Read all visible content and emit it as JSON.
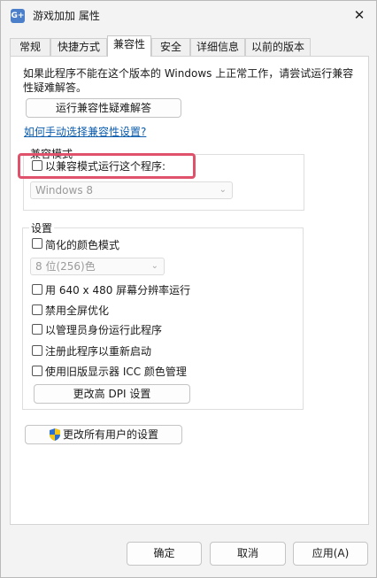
{
  "window": {
    "title": "游戏加加 属性",
    "app_icon_text": "G+",
    "close_glyph": "✕"
  },
  "tabs": [
    {
      "label": "常规"
    },
    {
      "label": "快捷方式"
    },
    {
      "label": "兼容性"
    },
    {
      "label": "安全"
    },
    {
      "label": "详细信息"
    },
    {
      "label": "以前的版本"
    }
  ],
  "compat": {
    "description": "如果此程序不能在这个版本的 Windows 上正常工作，请尝试运行兼容性疑难解答。",
    "troubleshoot_button": "运行兼容性疑难解答",
    "manual_link": "如何手动选择兼容性设置?",
    "mode_group": {
      "label": "兼容模式",
      "checkbox_label": "以兼容模式运行这个程序:",
      "checked": false,
      "os_select": "Windows 8"
    },
    "settings_group": {
      "label": "设置",
      "reduced_color": "简化的颜色模式",
      "color_select": "8 位(256)色",
      "resolution_640": "用 640 x 480 屏幕分辨率运行",
      "disable_fullscreen_opt": "禁用全屏优化",
      "run_as_admin": "以管理员身份运行此程序",
      "register_restart": "注册此程序以重新启动",
      "legacy_icc": "使用旧版显示器 ICC 颜色管理",
      "dpi_button": "更改高 DPI 设置"
    },
    "all_users_button": "更改所有用户的设置"
  },
  "footer": {
    "ok": "确定",
    "cancel": "取消",
    "apply": "应用(A)"
  },
  "colors": {
    "highlight_border": "#e0516b",
    "link": "#0b5cad"
  }
}
